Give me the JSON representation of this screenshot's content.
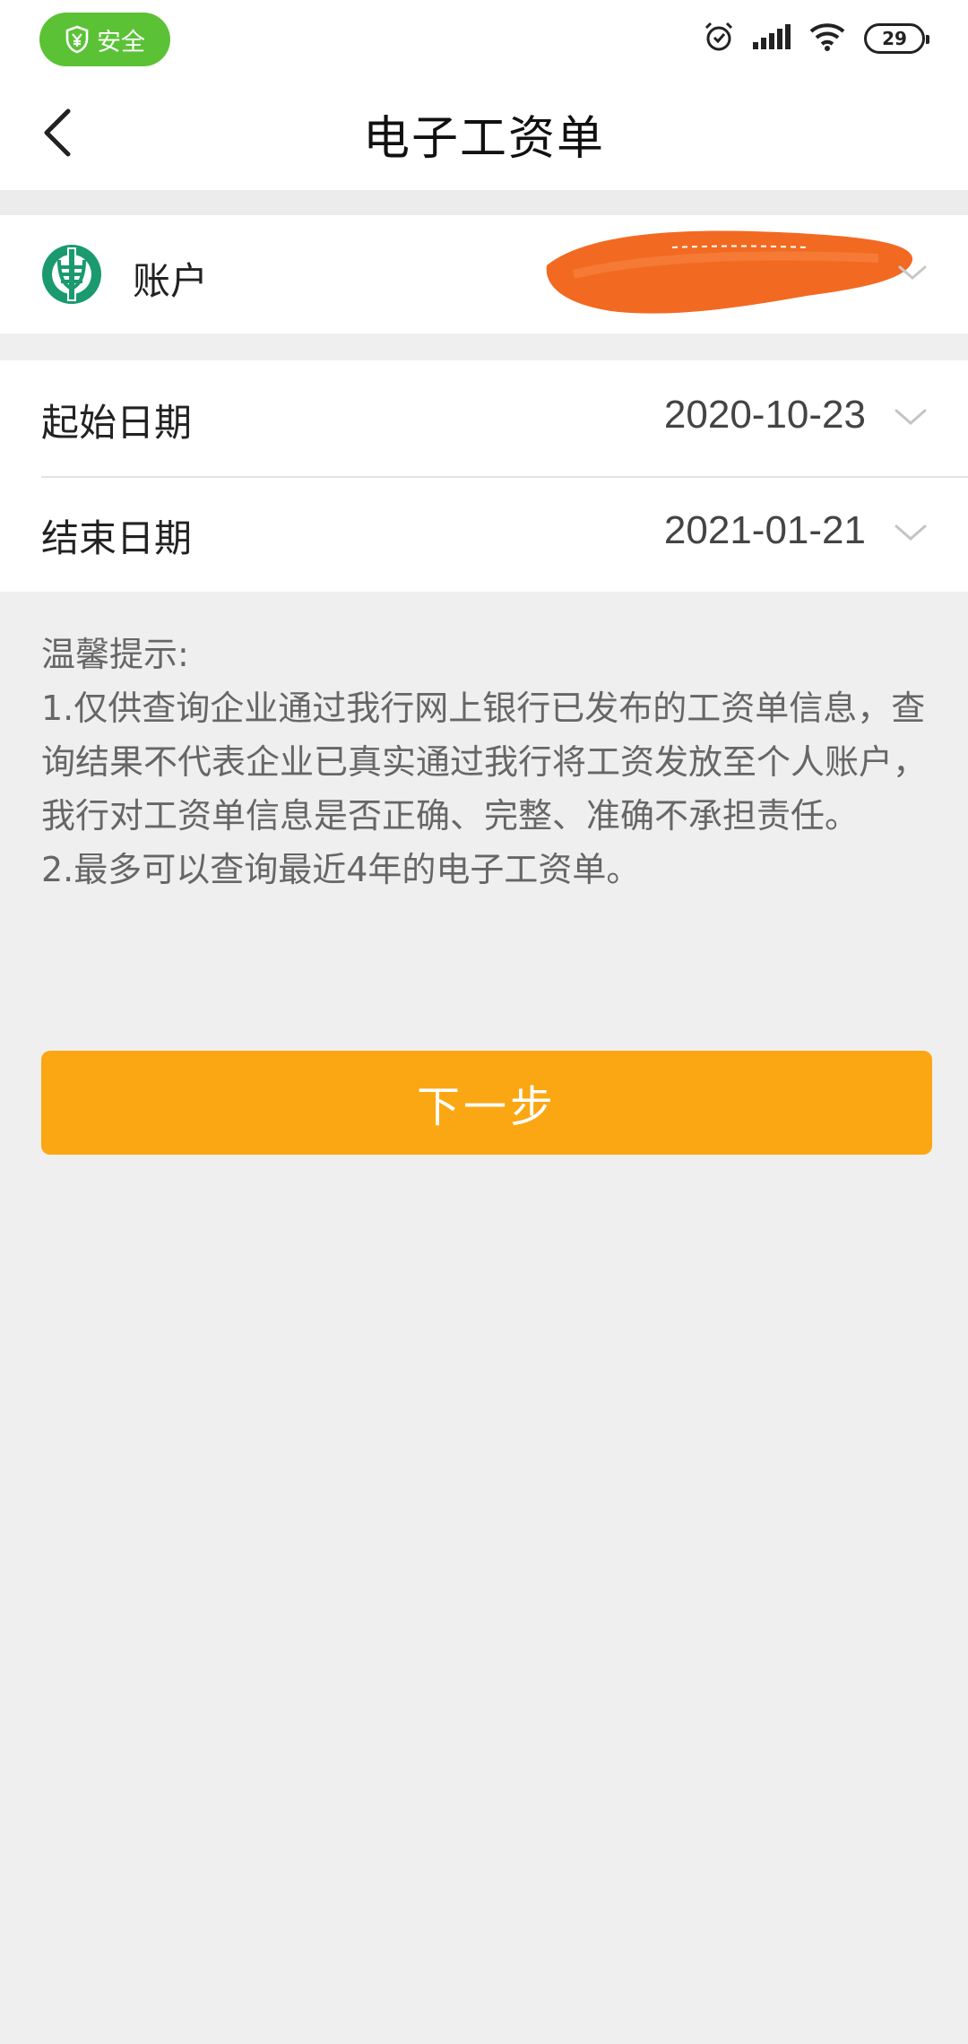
{
  "status_bar": {
    "safe_label": "安全",
    "battery_level": "29",
    "icons": [
      "shield-yen-icon",
      "alarm-icon",
      "signal-icon",
      "wifi-icon",
      "battery-icon"
    ]
  },
  "header": {
    "title": "电子工资单",
    "back_icon": "chevron-left-icon"
  },
  "account": {
    "label": "账户",
    "logo_icon": "bank-logo-icon"
  },
  "dates": {
    "start_label": "起始日期",
    "start_value": "2020-10-23",
    "end_label": "结束日期",
    "end_value": "2021-01-21"
  },
  "notice": {
    "title": "温馨提示:",
    "line1": "1.仅供查询企业通过我行网上银行已发布的工资单信息，查询结果不代表企业已真实通过我行将工资发放至个人账户，我行对工资单信息是否正确、完整、准确不承担责任。",
    "line2": "2.最多可以查询最近4年的电子工资单。"
  },
  "next_button": {
    "label": "下一步"
  },
  "colors": {
    "safe_green": "#5bc236",
    "bank_green": "#1a9a6e",
    "button_orange": "#fba714",
    "mask_orange": "#f26a22"
  }
}
